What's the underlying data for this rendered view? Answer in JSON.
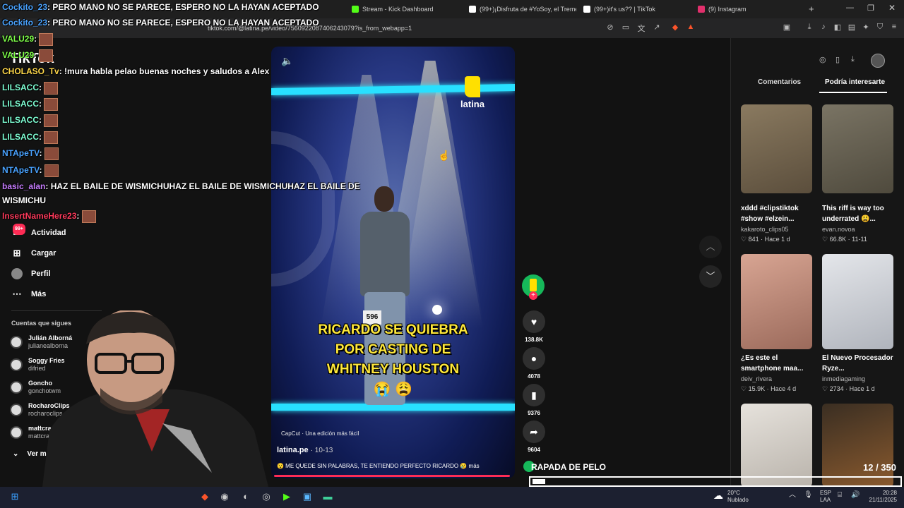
{
  "browser": {
    "tabs": [
      {
        "label": "Stream - Kick Dashboard",
        "color": "#53fc18"
      },
      {
        "label": "(99+)¡Disfruta de #YoSoy, el Tremen...",
        "color": "#ffffff"
      },
      {
        "label": "(99+)it's us?? | TikTok",
        "color": "#ffffff"
      },
      {
        "label": "(9) Instagram",
        "color": "#e1306c"
      }
    ],
    "url": "tiktok.com/@latina.pe/video/7560922087406243079?is_from_webapp=1"
  },
  "sidebar": {
    "logo": "TikTok",
    "items": [
      {
        "label": "Actividad",
        "icon": "message-icon",
        "glyph": "✉",
        "badge": "99+"
      },
      {
        "label": "Cargar",
        "icon": "upload-icon",
        "glyph": "⊞"
      },
      {
        "label": "Perfil",
        "icon": "profile-icon",
        "glyph": "●"
      },
      {
        "label": "Más",
        "icon": "more-icon",
        "glyph": "⋯"
      }
    ],
    "following_title": "Cuentas que sigues",
    "following": [
      {
        "name": "Julián Alborná",
        "handle": "julianealborna"
      },
      {
        "name": "Soggy Fries",
        "handle": "difried"
      },
      {
        "name": "Goncho",
        "handle": "gonchotwm"
      },
      {
        "name": "RocharoClips",
        "handle": "rocharoclips"
      },
      {
        "name": "mattcrazy24",
        "handle": "mattcrazyclips"
      }
    ],
    "see_more": "Ver más"
  },
  "video": {
    "brand": "latina",
    "caption_text": [
      "RICARDO SE QUIEBRA",
      "POR CASTING DE",
      "WHITNEY HOUSTON"
    ],
    "caption_emoji": "😭 😩",
    "bib_number": "596",
    "capcut": "CapCut · Una edición más fácil",
    "author": "latina.pe",
    "date": "· 10-13",
    "description": "😯 ME QUEDE SIN PALABRAS, TE ENTIENDO PERFECTO RICARDO 😢  más",
    "progress": 0.99
  },
  "actions": {
    "likes": "138.8K",
    "comments": "4078",
    "saves": "9376",
    "shares": "9604"
  },
  "right_panel": {
    "tabs": [
      "Comentarios",
      "Podría interesarte"
    ],
    "cards": [
      {
        "title": "xddd #clipstiktok #show #elzein...",
        "author": "kakaroto_clips05",
        "likes": "841",
        "time": "Hace 1 d",
        "thumb_color": "#7a6a54"
      },
      {
        "title": "This riff is way too underrated 😩...",
        "author": "evan.novoa",
        "likes": "66.8K",
        "time": "11-11",
        "thumb_color": "#6b6556"
      },
      {
        "title": "¿Es este el smartphone maa...",
        "author": "deiv_rivera",
        "likes": "15.9K",
        "time": "Hace 4 d",
        "thumb_color": "#c88f7b"
      },
      {
        "title": "El Nuevo Procesador Ryze...",
        "author": "inmediagaming",
        "likes": "2734",
        "time": "Hace 1 d",
        "thumb_color": "#d9dbe0"
      },
      {
        "title": "",
        "author": "",
        "likes": "",
        "time": "",
        "thumb_color": "#d8d4ce"
      },
      {
        "title": "",
        "author": "",
        "likes": "",
        "time": "",
        "thumb_color": "#4a3a28"
      }
    ]
  },
  "chat": [
    {
      "user": "Cockito_23",
      "msg": ": PERO MANO NO SE PARECE, ESPERO NO LA HAYAN ACEPTADO",
      "color": "#4aa3ff",
      "emote": false
    },
    {
      "user": "Cockito_23",
      "msg": ": PERO MANO NO SE PARECE, ESPERO NO LA HAYAN ACEPTADO",
      "color": "#4aa3ff",
      "emote": false
    },
    {
      "user": "VALU29",
      "msg": ":",
      "color": "#7fff4a",
      "emote": true
    },
    {
      "user": "VALU29",
      "msg": ":",
      "color": "#7fff4a",
      "emote": true
    },
    {
      "user": "CHOLASO_Tv",
      "msg": ": !mura habla pelao buenas noches y saludos a Alex",
      "color": "#ffd84a",
      "emote": false
    },
    {
      "user": "LILSACC",
      "msg": ":",
      "color": "#7fffd4",
      "emote": true
    },
    {
      "user": "LILSACC",
      "msg": ":",
      "color": "#7fffd4",
      "emote": true
    },
    {
      "user": "LILSACC",
      "msg": ":",
      "color": "#7fffd4",
      "emote": true
    },
    {
      "user": "LILSACC",
      "msg": ":",
      "color": "#7fffd4",
      "emote": true
    },
    {
      "user": "NTApeTV",
      "msg": ":",
      "color": "#4aa3ff",
      "emote": true
    },
    {
      "user": "NTApeTV",
      "msg": ":",
      "color": "#4aa3ff",
      "emote": true
    },
    {
      "user": "basic_alan",
      "msg": ": HAZ EL BAILE DE WISMICHUHAZ EL BAILE DE WISMICHUHAZ EL BAILE DE",
      "color": "#c77dff",
      "emote": false
    },
    {
      "user": "",
      "msg": "WISMICHU",
      "color": "#ffffff",
      "emote": false
    },
    {
      "user": "InsertNameHere23",
      "msg": ":",
      "color": "#ff3b5c",
      "emote": true
    }
  ],
  "overlay": {
    "title": "RAPADA DE PELO",
    "counter": "12 / 350",
    "progress": 0.034
  },
  "taskbar": {
    "weather_temp": "20°C",
    "weather_desc": "Nublado",
    "lang": "ESP",
    "lang2": "LAA",
    "time": "20:28",
    "date": "21/11/2025"
  }
}
